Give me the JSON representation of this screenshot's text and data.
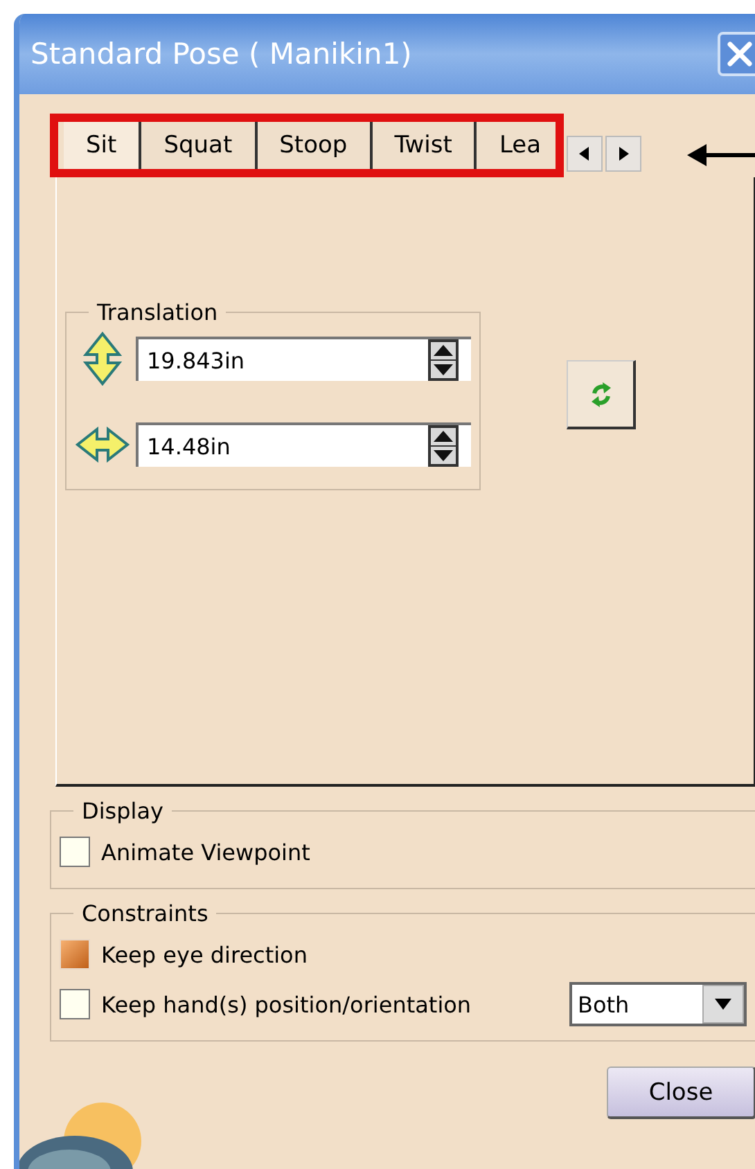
{
  "window": {
    "title": "Standard Pose ( Manikin1)"
  },
  "tabs": [
    {
      "label": "Sit",
      "selected": true
    },
    {
      "label": "Squat",
      "selected": false
    },
    {
      "label": "Stoop",
      "selected": false
    },
    {
      "label": "Twist",
      "selected": false
    },
    {
      "label": "Lea",
      "selected": false
    }
  ],
  "translation": {
    "title": "Translation",
    "fields": [
      {
        "kind": "vertical",
        "value": "19.843in"
      },
      {
        "kind": "horizontal",
        "value": "14.48in"
      }
    ]
  },
  "display": {
    "title": "Display",
    "options": [
      {
        "label": "Animate Viewpoint",
        "checked": false
      }
    ]
  },
  "constraints": {
    "title": "Constraints",
    "options": [
      {
        "label": "Keep eye direction",
        "checked": true
      },
      {
        "label": "Keep hand(s) position/orientation",
        "checked": false
      }
    ],
    "dropdown": "Both"
  },
  "buttons": [
    "Close"
  ]
}
